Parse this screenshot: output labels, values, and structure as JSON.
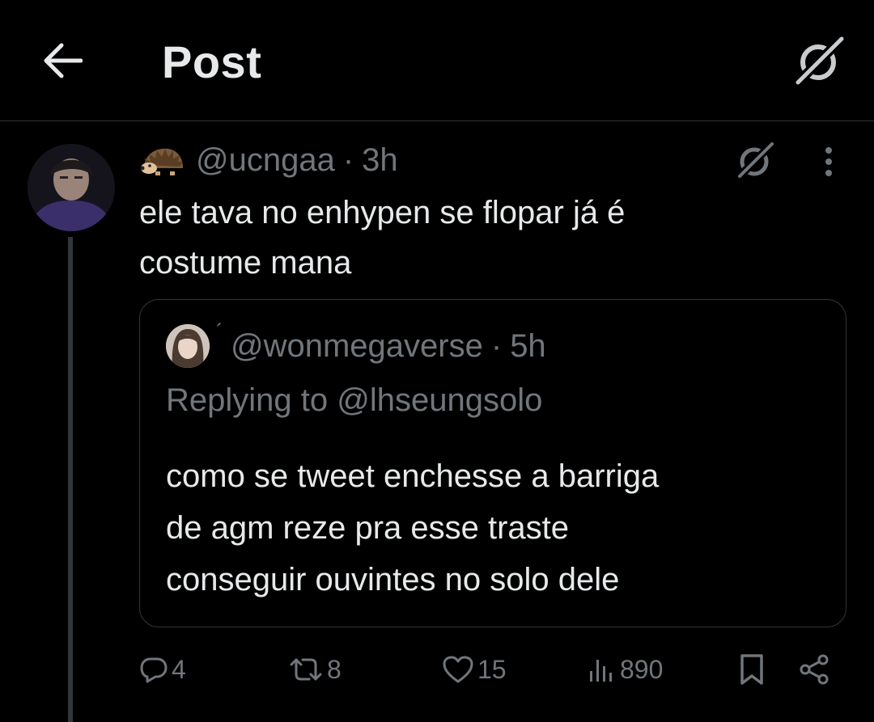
{
  "header": {
    "title": "Post"
  },
  "tweet": {
    "handle": "@ucngaa",
    "separator": "·",
    "time": "3h",
    "text": "ele tava no enhypen se flopar já é\ncostume mana"
  },
  "quote": {
    "handle": "@wonmegaverse",
    "mark": "´",
    "separator": "·",
    "time": "5h",
    "replying_prefix": "Replying to",
    "replying_handle": "@lhseungsolo",
    "text": "como se tweet enchesse a barriga\nde agm reze pra esse traste\nconseguir ouvintes no solo dele"
  },
  "actions": {
    "replies": "4",
    "reposts": "8",
    "likes": "15",
    "views": "890"
  },
  "icons": [
    "back-arrow-icon",
    "grok-icon",
    "hedgehog-emoji-icon",
    "more-dots-icon",
    "reply-icon",
    "repost-icon",
    "like-icon",
    "views-icon",
    "bookmark-icon",
    "share-icon"
  ],
  "colors": {
    "background": "#000000",
    "text": "#e7e9ea",
    "secondary": "#71767b",
    "divider": "#2f3336"
  }
}
